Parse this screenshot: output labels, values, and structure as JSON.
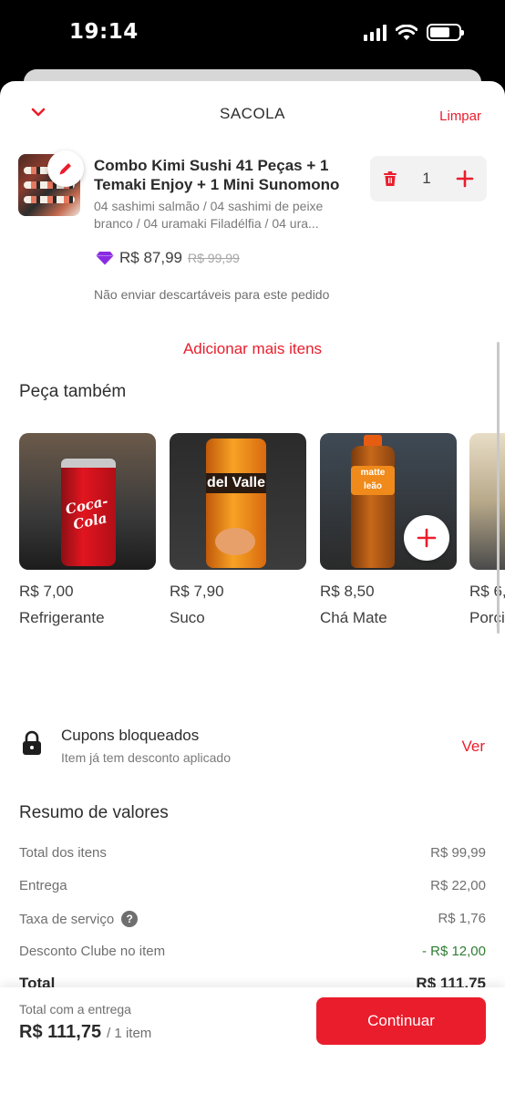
{
  "status_bar": {
    "time": "19:14"
  },
  "header": {
    "title": "SACOLA",
    "clear_label": "Limpar"
  },
  "cart_item": {
    "name": "Combo Kimi Sushi 41 Peças + 1 Temaki Enjoy + 1 Mini Sunomono",
    "description": "04 sashimi salmão / 04 sashimi de peixe branco / 04 uramaki Filadélfia / 04 ura...",
    "quantity": "1",
    "price": "R$ 87,99",
    "old_price": "R$ 99,99",
    "note": "Não enviar descartáveis para este pedido"
  },
  "add_more_label": "Adicionar mais itens",
  "suggestions": {
    "title": "Peça também",
    "items": [
      {
        "price": "R$ 7,00",
        "name": "Refrigerante",
        "brand_text": "Coca-Cola"
      },
      {
        "price": "R$ 7,90",
        "name": "Suco",
        "brand_text": "del Valle"
      },
      {
        "price": "R$ 8,50",
        "name": "Chá Mate",
        "brand_text": "matte leão"
      },
      {
        "price": "R$ 6,",
        "name": "Porçi"
      }
    ]
  },
  "coupons": {
    "title": "Cupons bloqueados",
    "subtitle": "Item já tem desconto aplicado",
    "link_label": "Ver"
  },
  "summary": {
    "title": "Resumo de valores",
    "rows": [
      {
        "label": "Total dos itens",
        "value": "R$ 99,99"
      },
      {
        "label": "Entrega",
        "value": "R$ 22,00"
      },
      {
        "label": "Taxa de serviço",
        "value": "R$ 1,76"
      },
      {
        "label": "Desconto Clube no item",
        "value": "- R$ 12,00"
      }
    ],
    "total_label": "Total",
    "total_value": "R$ 111,75"
  },
  "footer": {
    "label": "Total com a entrega",
    "amount": "R$ 111,75",
    "count": "/ 1 item",
    "continue_label": "Continuar"
  },
  "colors": {
    "accent": "#ea1d2c",
    "discount": "#2e7d32",
    "club": "#8a2be2"
  }
}
